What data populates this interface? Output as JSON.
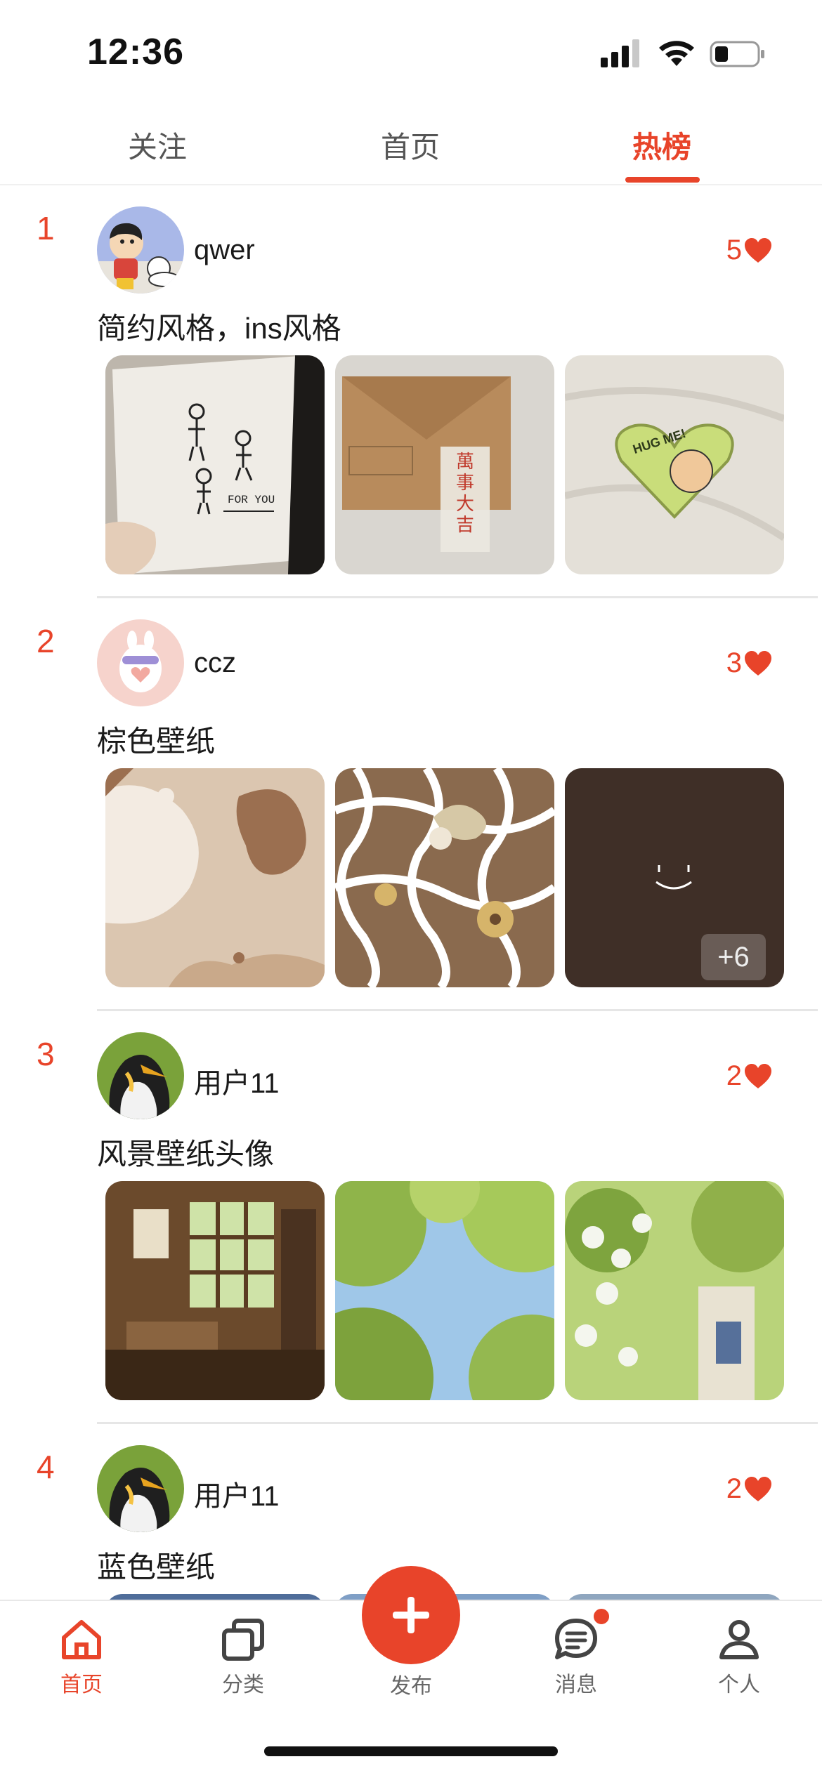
{
  "status_bar": {
    "time": "12:36"
  },
  "top_tabs": [
    {
      "label": "关注",
      "active": false
    },
    {
      "label": "首页",
      "active": false
    },
    {
      "label": "热榜",
      "active": true
    }
  ],
  "posts": [
    {
      "rank": "1",
      "username": "qwer",
      "likes": "5",
      "title": "简约风格，ins风格",
      "more": ""
    },
    {
      "rank": "2",
      "username": "ccz",
      "likes": "3",
      "title": "棕色壁纸",
      "more": "+6"
    },
    {
      "rank": "3",
      "username": "用户11",
      "likes": "2",
      "title": "风景壁纸头像",
      "more": ""
    },
    {
      "rank": "4",
      "username": "用户11",
      "likes": "2",
      "title": "蓝色壁纸",
      "more": ""
    }
  ],
  "bottom_nav": {
    "home": "首页",
    "category": "分类",
    "publish": "发布",
    "messages": "消息",
    "profile": "个人"
  },
  "colors": {
    "accent": "#e8442a"
  },
  "icons": {
    "like": "heart-icon",
    "home": "home-icon",
    "category": "layers-icon",
    "publish": "plus-icon",
    "messages": "chat-icon",
    "profile": "person-icon"
  }
}
